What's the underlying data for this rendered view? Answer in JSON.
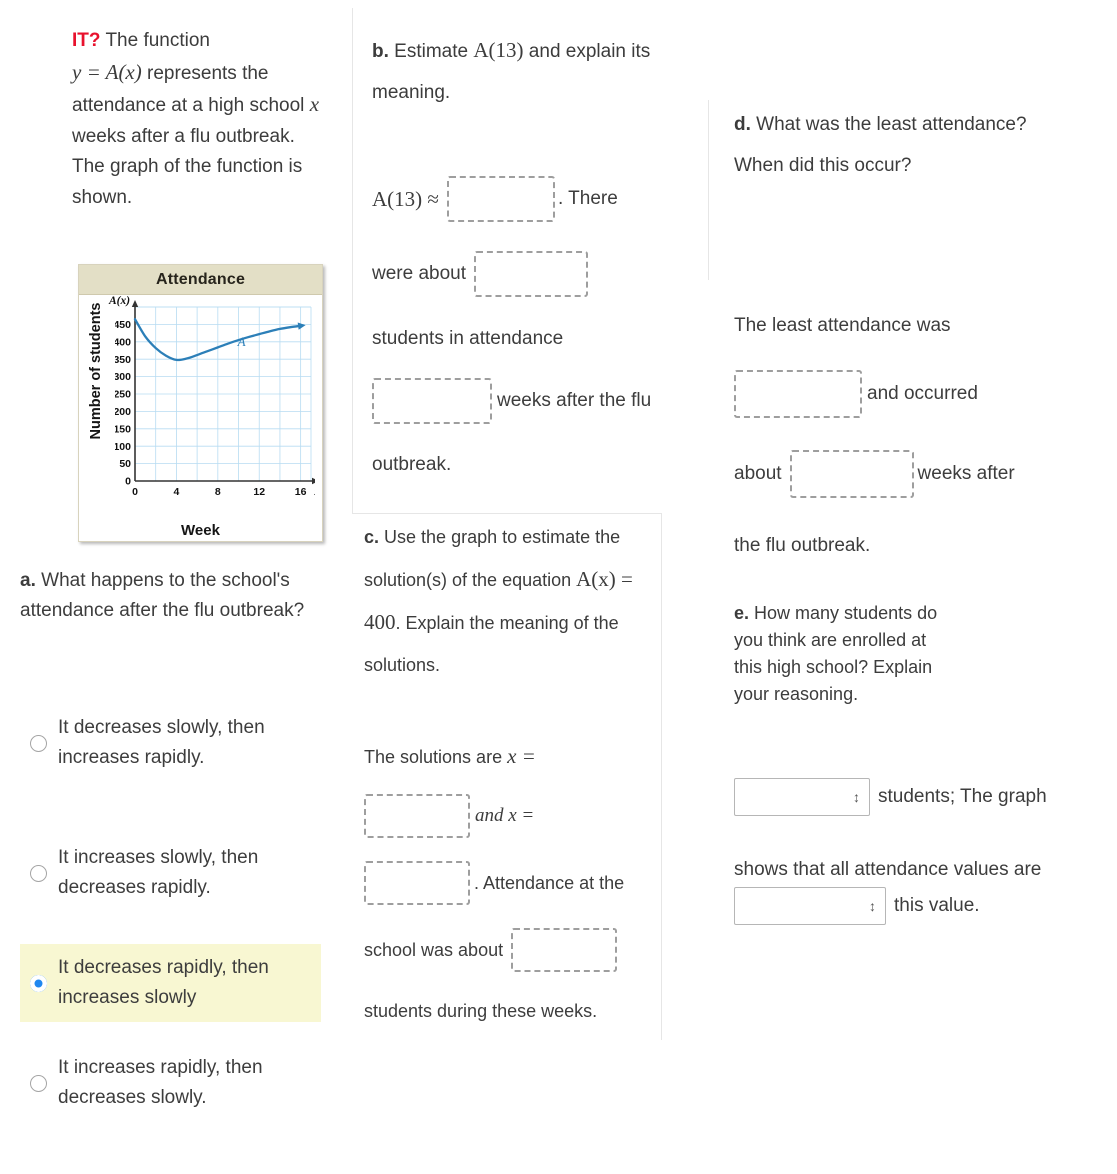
{
  "problem": {
    "tag": "IT?",
    "stem_line1": "The function",
    "stem_math": "y = A(x)",
    "stem_rest": " represents the attendance at a high school ",
    "stem_x": "x",
    "stem_rest2": " weeks after a flu outbreak. The graph of the function is shown."
  },
  "chart_data": {
    "type": "line",
    "title": "Attendance",
    "xlabel": "Week",
    "ylabel": "Number of students",
    "y_axis_caption": "A(x)",
    "x_axis_caption": "x",
    "xlim": [
      0,
      17
    ],
    "ylim": [
      0,
      500
    ],
    "xticks": [
      0,
      4,
      8,
      12,
      16
    ],
    "yticks": [
      0,
      50,
      100,
      150,
      200,
      250,
      300,
      350,
      400,
      450
    ],
    "grid": true,
    "curve_label": "A",
    "series": [
      {
        "name": "A",
        "points": [
          [
            0,
            465
          ],
          [
            1,
            415
          ],
          [
            2,
            382
          ],
          [
            3,
            360
          ],
          [
            4,
            348
          ],
          [
            5,
            352
          ],
          [
            6,
            362
          ],
          [
            7,
            373
          ],
          [
            8,
            384
          ],
          [
            9,
            395
          ],
          [
            10,
            405
          ],
          [
            11,
            414
          ],
          [
            12,
            422
          ],
          [
            13,
            430
          ],
          [
            14,
            437
          ],
          [
            15,
            442
          ],
          [
            16,
            446
          ]
        ]
      }
    ],
    "line_color": "#2c7fb8",
    "grid_color": "#b7dcf2"
  },
  "part_a": {
    "label": "a.",
    "question": "What happens to the school's attendance after the flu outbreak?",
    "options": [
      {
        "text": "It decreases slowly, then increases rapidly.",
        "selected": false
      },
      {
        "text": "It increases slowly, then decreases rapidly.",
        "selected": false
      },
      {
        "text": "It decreases rapidly, then increases slowly",
        "selected": true
      },
      {
        "text": "It increases rapidly, then decreases slowly.",
        "selected": false
      }
    ],
    "highlight_color": "#f8f7d2",
    "radio_selected_color": "#1f87f0"
  },
  "part_b": {
    "label": "b.",
    "question_1": "Estimate ",
    "question_math": "A(13)",
    "question_2": " and explain its meaning.",
    "answer_math": "A(13) ≈",
    "after_box1": ". There",
    "line_were_about": "were about",
    "line_students": "students in attendance",
    "after_box3": "weeks after the flu",
    "line_outbreak": "outbreak.",
    "box1_value": "",
    "box2_value": "",
    "box3_value": ""
  },
  "part_c": {
    "label": "c.",
    "question_1": "Use the graph to estimate the solution(s) of the equation ",
    "question_math": "A(x) = 400",
    "question_2": ". Explain the meaning of the solutions.",
    "line_solutions_1": "The solutions are ",
    "solutions_x": "x =",
    "and_x": "and x =",
    "after_box2": ". Attendance at the",
    "line_school_was_about": "school was about",
    "line_students_during": "students during these weeks.",
    "box1_value": "",
    "box2_value": "",
    "box3_value": ""
  },
  "part_d": {
    "label": "d.",
    "question": "What was the least attendance? When did this occur?",
    "line_least": "The least attendance was",
    "after_box1": "and occurred",
    "about": "about",
    "after_box2": "weeks after",
    "line_end": "the flu outbreak.",
    "box1_value": "",
    "box2_value": ""
  },
  "part_e": {
    "label": "e.",
    "question": "How many students do you think are enrolled at this high school? Explain your reasoning.",
    "after_select1": "students; The graph",
    "line_shows": "shows that all attendance values are",
    "after_select2": "this value.",
    "select1_value": "",
    "select2_value": "",
    "caret_icon": "updown-caret-icon"
  }
}
